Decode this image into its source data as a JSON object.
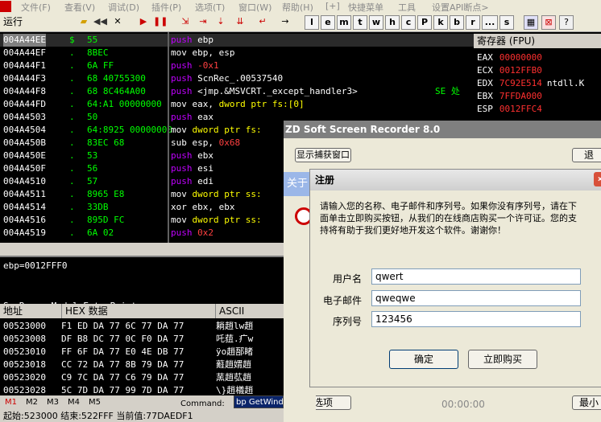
{
  "menu": [
    "文件(F)",
    "查看(V)",
    "调试(D)",
    "插件(P)",
    "选项(T)",
    "窗口(W)",
    "帮助(H)",
    "[+]",
    "快捷菜单",
    "工具",
    "设置API断点>"
  ],
  "toolbar": {
    "status": "运行",
    "letters": [
      "l",
      "e",
      "m",
      "t",
      "w",
      "h",
      "c",
      "P",
      "k",
      "b",
      "r",
      "...",
      "s"
    ]
  },
  "cpu_rows": [
    {
      "addr": "004A44EE",
      "mark": "$",
      "hex": "55",
      "dis": [
        {
          "c": "m",
          "t": "push "
        },
        {
          "c": "t",
          "t": "ebp"
        }
      ],
      "cmt": ""
    },
    {
      "addr": "004A44EF",
      "mark": ".",
      "hex": "8BEC",
      "dis": [
        {
          "c": "t",
          "t": "mov ebp, esp"
        }
      ],
      "cmt": ""
    },
    {
      "addr": "004A44F1",
      "mark": ".",
      "hex": "6A FF",
      "dis": [
        {
          "c": "m",
          "t": "push "
        },
        {
          "c": "r",
          "t": "-0x1"
        }
      ],
      "cmt": ""
    },
    {
      "addr": "004A44F3",
      "mark": ".",
      "hex": "68 40755300",
      "dis": [
        {
          "c": "m",
          "t": "push "
        },
        {
          "c": "t",
          "t": "ScnRec_.00537540"
        }
      ],
      "cmt": ""
    },
    {
      "addr": "004A44F8",
      "mark": ".",
      "hex": "68 8C464A00",
      "dis": [
        {
          "c": "m",
          "t": "push "
        },
        {
          "c": "t",
          "t": "<jmp.&MSVCRT._except_handler3>"
        }
      ],
      "cmt": "SE 处"
    },
    {
      "addr": "004A44FD",
      "mark": ".",
      "hex": "64:A1 00000000",
      "dis": [
        {
          "c": "t",
          "t": "mov eax, "
        },
        {
          "c": "y",
          "t": "dword ptr fs:[0]"
        }
      ],
      "cmt": ""
    },
    {
      "addr": "004A4503",
      "mark": ".",
      "hex": "50",
      "dis": [
        {
          "c": "m",
          "t": "push "
        },
        {
          "c": "t",
          "t": "eax"
        }
      ],
      "cmt": ""
    },
    {
      "addr": "004A4504",
      "mark": ".",
      "hex": "64:8925 00000000",
      "dis": [
        {
          "c": "t",
          "t": "mov "
        },
        {
          "c": "y",
          "t": "dword ptr fs:"
        }
      ],
      "cmt": ""
    },
    {
      "addr": "004A450B",
      "mark": ".",
      "hex": "83EC 68",
      "dis": [
        {
          "c": "t",
          "t": "sub esp, "
        },
        {
          "c": "r",
          "t": "0x68"
        }
      ],
      "cmt": ""
    },
    {
      "addr": "004A450E",
      "mark": ".",
      "hex": "53",
      "dis": [
        {
          "c": "m",
          "t": "push "
        },
        {
          "c": "t",
          "t": "ebx"
        }
      ],
      "cmt": ""
    },
    {
      "addr": "004A450F",
      "mark": ".",
      "hex": "56",
      "dis": [
        {
          "c": "m",
          "t": "push "
        },
        {
          "c": "t",
          "t": "esi"
        }
      ],
      "cmt": ""
    },
    {
      "addr": "004A4510",
      "mark": ".",
      "hex": "57",
      "dis": [
        {
          "c": "m",
          "t": "push "
        },
        {
          "c": "t",
          "t": "edi"
        }
      ],
      "cmt": ""
    },
    {
      "addr": "004A4511",
      "mark": ".",
      "hex": "8965 E8",
      "dis": [
        {
          "c": "t",
          "t": "mov "
        },
        {
          "c": "y",
          "t": "dword ptr ss:"
        }
      ],
      "cmt": ""
    },
    {
      "addr": "004A4514",
      "mark": ".",
      "hex": "33DB",
      "dis": [
        {
          "c": "t",
          "t": "xor ebx, ebx"
        }
      ],
      "cmt": ""
    },
    {
      "addr": "004A4516",
      "mark": ".",
      "hex": "895D FC",
      "dis": [
        {
          "c": "t",
          "t": "mov "
        },
        {
          "c": "y",
          "t": "dword ptr ss:"
        }
      ],
      "cmt": ""
    },
    {
      "addr": "004A4519",
      "mark": ".",
      "hex": "6A 02",
      "dis": [
        {
          "c": "m",
          "t": "push "
        },
        {
          "c": "r",
          "t": "0x2"
        }
      ],
      "cmt": ""
    }
  ],
  "registers": {
    "header": "寄存器 (FPU)",
    "rows": [
      {
        "n": "EAX",
        "v": "00000000",
        "s": ""
      },
      {
        "n": "ECX",
        "v": "0012FFB0",
        "s": ""
      },
      {
        "n": "EDX",
        "v": "7C92E514",
        "s": "ntdll.K"
      },
      {
        "n": "EBX",
        "v": "7FFDA000",
        "s": ""
      },
      {
        "n": "ESP",
        "v": "0012FFC4",
        "s": ""
      }
    ]
  },
  "info_text": "ebp=0012FFF0",
  "info_text2": "ScnRec_.<ModuleEntryPoint>",
  "dump": {
    "headers": [
      "地址",
      "HEX 数据",
      "ASCII"
    ],
    "rows": [
      {
        "a": "00523000",
        "h": "F1 ED DA 77 6C 77 DA 77",
        "s": "耥趙lw趙"
      },
      {
        "a": "00523008",
        "h": "DF B8 DC 77 0C F0 DA 77",
        "s": "吒莥.疒w"
      },
      {
        "a": "00523010",
        "h": "FF 6F DA 77 E0 4E DB 77",
        "s": "ÿo趙郚睹"
      },
      {
        "a": "00523018",
        "h": "CC 72 DA 77 8B 79 DA 77",
        "s": "蘳趙媦趙"
      },
      {
        "a": "00523020",
        "h": "C9 7C DA 77 C6 79 DA 77",
        "s": "蓔趙苰趙"
      },
      {
        "a": "00523028",
        "h": "5C 7D DA 77 99 7D DA 77",
        "s": "\\}趙檥趙"
      }
    ]
  },
  "cmd": {
    "tabs": [
      "M1",
      "M2",
      "M3",
      "M4",
      "M5"
    ],
    "label": "Command:",
    "value": "bp GetWind"
  },
  "status": "起始:523000 结束:522FFF 当前值:77DAEDF1",
  "zd": {
    "title": "ZD Soft Screen Recorder 8.0",
    "show_capture": "显示捕获窗口",
    "exit": "退",
    "options": "选项",
    "time": "00:00:00",
    "min": "最小"
  },
  "about": {
    "title": "关于"
  },
  "register": {
    "title": "注册",
    "desc": [
      "请输入您的名称、电子邮件和序列号。如果你没有序列号，请在下",
      "面单击立即购买按钮，从我们的在线商店购买一个许可证。您的支",
      "持将有助于我们更好地开发这个软件。谢谢你！"
    ],
    "fields": [
      {
        "label": "用户名",
        "value": "qwert"
      },
      {
        "label": "电子邮件",
        "value": "qweqwe"
      },
      {
        "label": "序列号",
        "value": "123456"
      }
    ],
    "ok": "确定",
    "buy": "立即购买"
  }
}
